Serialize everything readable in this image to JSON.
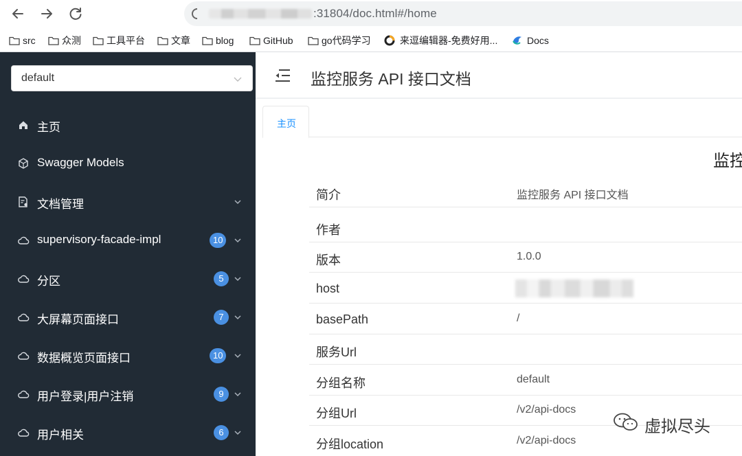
{
  "browser": {
    "url_visible": ":31804/doc.html#/home",
    "bookmarks": [
      {
        "label": "src",
        "icon": "folder-icon"
      },
      {
        "label": "众测",
        "icon": "folder-icon"
      },
      {
        "label": "工具平台",
        "icon": "folder-icon"
      },
      {
        "label": "文章",
        "icon": "folder-icon"
      },
      {
        "label": "blog",
        "icon": "folder-icon"
      },
      {
        "label": "GitHub",
        "icon": "folder-icon"
      },
      {
        "label": "go代码学习",
        "icon": "folder-icon"
      },
      {
        "label": "来逗编辑器-免费好用...",
        "icon": "site-icon"
      },
      {
        "label": "Docs",
        "icon": "site-icon"
      }
    ]
  },
  "sidebar": {
    "group_select": "default",
    "items": [
      {
        "label": "主页",
        "icon": "home-icon",
        "badge": null
      },
      {
        "label": "Swagger Models",
        "icon": "cube-icon",
        "badge": null
      },
      {
        "label": "文档管理",
        "icon": "doc-manage-icon",
        "badge": null
      },
      {
        "label": "supervisory-facade-impl",
        "icon": "cloud-icon",
        "badge": "10"
      },
      {
        "label": "分区",
        "icon": "cloud-icon",
        "badge": "5"
      },
      {
        "label": "大屏幕页面接口",
        "icon": "cloud-icon",
        "badge": "7"
      },
      {
        "label": "数据概览页面接口",
        "icon": "cloud-icon",
        "badge": "10"
      },
      {
        "label": "用户登录|用户注销",
        "icon": "cloud-icon",
        "badge": "9"
      },
      {
        "label": "用户相关",
        "icon": "cloud-icon",
        "badge": "6"
      }
    ]
  },
  "header": {
    "title": "监控服务 API 接口文档"
  },
  "tabs": [
    {
      "label": "主页",
      "active": true
    }
  ],
  "content": {
    "title_cut": "监控",
    "rows": [
      {
        "key": "简介",
        "value": "监控服务 API 接口文档"
      },
      {
        "key": "作者",
        "value": ""
      },
      {
        "key": "版本",
        "value": "1.0.0"
      },
      {
        "key": "host",
        "value": ""
      },
      {
        "key": "basePath",
        "value": "/"
      },
      {
        "key": "服务Url",
        "value": ""
      },
      {
        "key": "分组名称",
        "value": "default"
      },
      {
        "key": "分组Url",
        "value": "/v2/api-docs"
      },
      {
        "key": "分组location",
        "value": "/v2/api-docs"
      }
    ]
  },
  "watermark": {
    "text": "虚拟尽头"
  },
  "colors": {
    "sidebar_bg": "#212b35",
    "badge_bg": "#4a90e2",
    "accent": "#1890ff"
  }
}
